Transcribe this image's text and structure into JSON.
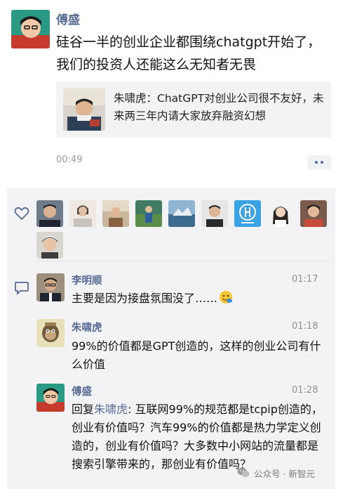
{
  "post": {
    "author": "傅盛",
    "text": "硅谷一半的创业企业都围绕chatgpt开始了，我们的投资人还能这么无知者无畏",
    "time": "00:49",
    "shared": {
      "text": "朱啸虎：ChatGPT对创业公司很不友好，未来两三年内请大家放弃融资幻想"
    }
  },
  "comments": [
    {
      "name": "李明顺",
      "time": "01:17",
      "text": "主要是因为接盘氛围没了……"
    },
    {
      "name": "朱啸虎",
      "time": "01:18",
      "text": "99%的价值都是GPT创造的，这样的创业公司有什么价值"
    },
    {
      "name": "傅盛",
      "time": "01:28",
      "reply_prefix": "回复",
      "reply_to": "朱啸虎",
      "reply_text": ": 互联网99%的规范都是tcpip创造的，创业有价值吗？汽车99%的价值都是热力学定义创造的，创业有价值吗？大多数中小网站的流量都是搜索引擎带来的，那创业有价值吗？"
    }
  ],
  "likes": {
    "count": 11
  },
  "watermark": "公众号 · 新智元",
  "icons": [
    "heart-icon",
    "comment-icon",
    "more-icon",
    "wechat-logo-icon"
  ]
}
